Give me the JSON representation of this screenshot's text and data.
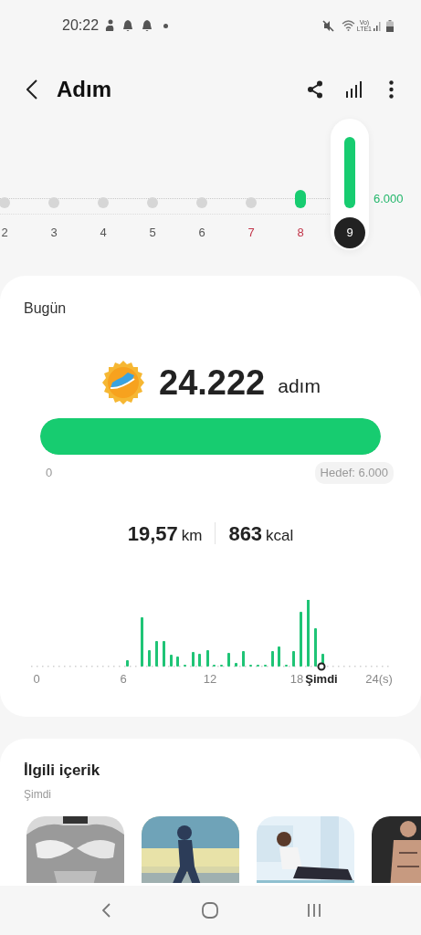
{
  "status_bar": {
    "time": "20:22",
    "network_top": "Vo)",
    "network_bottom": "LTE1"
  },
  "header": {
    "title": "Adım"
  },
  "week": {
    "goal_label": "6.000",
    "days": [
      {
        "label": "2",
        "selected": false,
        "weekend": false,
        "kind": "empty"
      },
      {
        "label": "3",
        "selected": false,
        "weekend": false,
        "kind": "empty"
      },
      {
        "label": "4",
        "selected": false,
        "weekend": false,
        "kind": "empty"
      },
      {
        "label": "5",
        "selected": false,
        "weekend": false,
        "kind": "empty"
      },
      {
        "label": "6",
        "selected": false,
        "weekend": false,
        "kind": "empty"
      },
      {
        "label": "7",
        "selected": false,
        "weekend": true,
        "kind": "empty"
      },
      {
        "label": "8",
        "selected": false,
        "weekend": true,
        "kind": "partial"
      },
      {
        "label": "9",
        "selected": true,
        "weekend": false,
        "kind": "goal"
      }
    ]
  },
  "today": {
    "title": "Bugün",
    "steps": "24.222",
    "steps_unit": "adım",
    "level": 1,
    "min_label": "0",
    "goal_label": "Hedef: 6.000",
    "distance": "19,57",
    "distance_unit": "km",
    "calories": "863",
    "calories_unit": "kcal",
    "hourly_axis": [
      "0",
      "6",
      "12",
      "18",
      "24(s)"
    ],
    "now_label": "Şimdi"
  },
  "related": {
    "title": "İlgili içerik",
    "subtitle": "Şimdi"
  }
}
